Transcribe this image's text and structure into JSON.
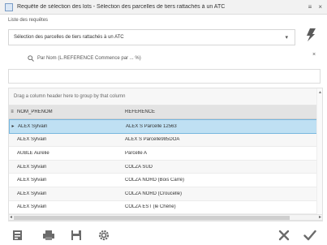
{
  "window": {
    "title": "Requête de sélection des lots - Sélection des parcelles de tiers rattachés à un ATC",
    "buttons": [
      "≡",
      "×"
    ]
  },
  "query": {
    "label": "Liste des requêtes",
    "selected": "Sélection des parcelles de tiers rattachés à un ATC"
  },
  "filter": {
    "criteria": "Par Nom (L.REFERENCE Commence par ... %)",
    "value": ""
  },
  "grid": {
    "group_hint": "Drag a column header here to group by that column",
    "columns": [
      "NOM_PRENOM",
      "REFERENCE"
    ],
    "rows": [
      {
        "name": "ALEX Sylvain",
        "ref": "ALEX S Parcelle 12563",
        "selected": true
      },
      {
        "name": "ALEX Sylvain",
        "ref": "ALEX S Parcelle985DOA",
        "selected": false
      },
      {
        "name": "AUBLE Aurelie",
        "ref": "Parcelle A",
        "selected": false
      },
      {
        "name": "ALEX Sylvain",
        "ref": "COLZA SUD",
        "selected": false
      },
      {
        "name": "ALEX Sylvain",
        "ref": "COLZA NORD (Bois Carré)",
        "selected": false
      },
      {
        "name": "ALEX Sylvain",
        "ref": "COLZA NORD (Croucelle)",
        "selected": false
      },
      {
        "name": "ALEX Sylvain",
        "ref": "COLZA EST (le Chêne)",
        "selected": false
      }
    ]
  },
  "toolbar": {
    "icons": [
      "chart-icon",
      "print-icon",
      "save-icon",
      "settings-icon",
      "close-icon",
      "check-icon"
    ]
  },
  "colors": {
    "selected_row": "#bfe0f3",
    "header_bg": "#e3e3e3",
    "icon_gray": "#6b6b6b"
  }
}
